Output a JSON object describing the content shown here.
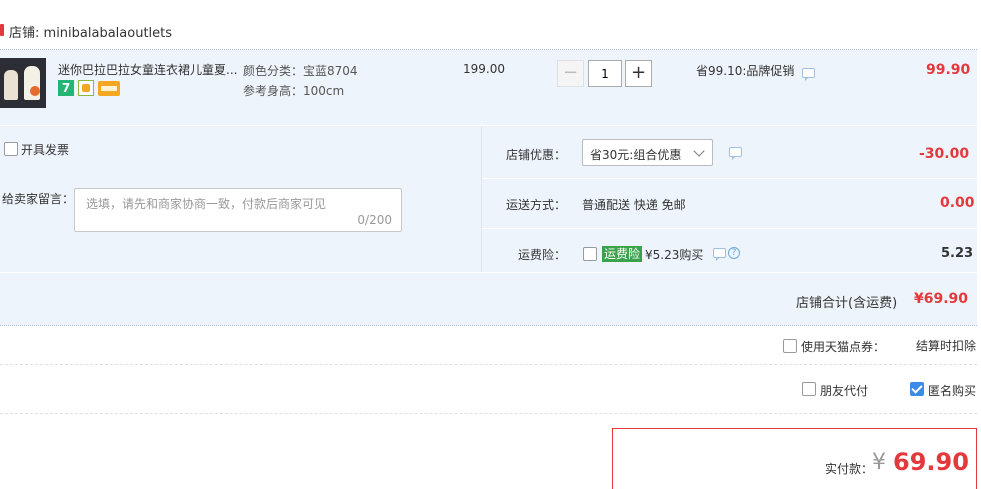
{
  "shop": {
    "label": "店铺:",
    "name": "minibalabalaoutlets"
  },
  "item": {
    "title": "迷你巴拉巴拉女童连衣裙儿童夏...",
    "badge_seven": "7",
    "color_spec": "颜色分类：宝蓝8704",
    "height_spec": "参考身高：100cm",
    "unit_price": "199.00",
    "quantity": "1",
    "minus_label": "−",
    "plus_label": "+",
    "promotion": "省99.10:品牌促销",
    "subtotal": "99.90"
  },
  "invoice": {
    "label": "开具发票",
    "checked": false
  },
  "message": {
    "label": "给卖家留言：",
    "placeholder": "选填，请先和商家协商一致，付款后商家可见",
    "counter": "0/200"
  },
  "shop_discount": {
    "label": "店铺优惠：",
    "selected": "省30元:组合优惠",
    "amount": "-30.00"
  },
  "shipping": {
    "label": "运送方式：",
    "method": "普通配送 快递 免邮",
    "amount": "0.00"
  },
  "shipping_insurance": {
    "label": "运费险：",
    "tag": "运费险",
    "price_text": "¥5.23购买",
    "help": "?",
    "amount": "5.23"
  },
  "shop_total": {
    "label": "店铺合计(含运费)",
    "amount": "¥69.90"
  },
  "points": {
    "label": "使用天猫点券：",
    "note": "结算时扣除"
  },
  "friend_pay": {
    "label": "朋友代付",
    "checked": false
  },
  "anonymous": {
    "label": "匿名购买",
    "checked": true
  },
  "payment": {
    "label": "实付款：",
    "currency": "¥",
    "amount": "69.90"
  },
  "colors": {
    "accent_red": "#e4393c",
    "light_blue_bg": "#eef4fb",
    "checkbox_blue": "#3c8ce7",
    "insurance_green": "#3aa24b"
  }
}
